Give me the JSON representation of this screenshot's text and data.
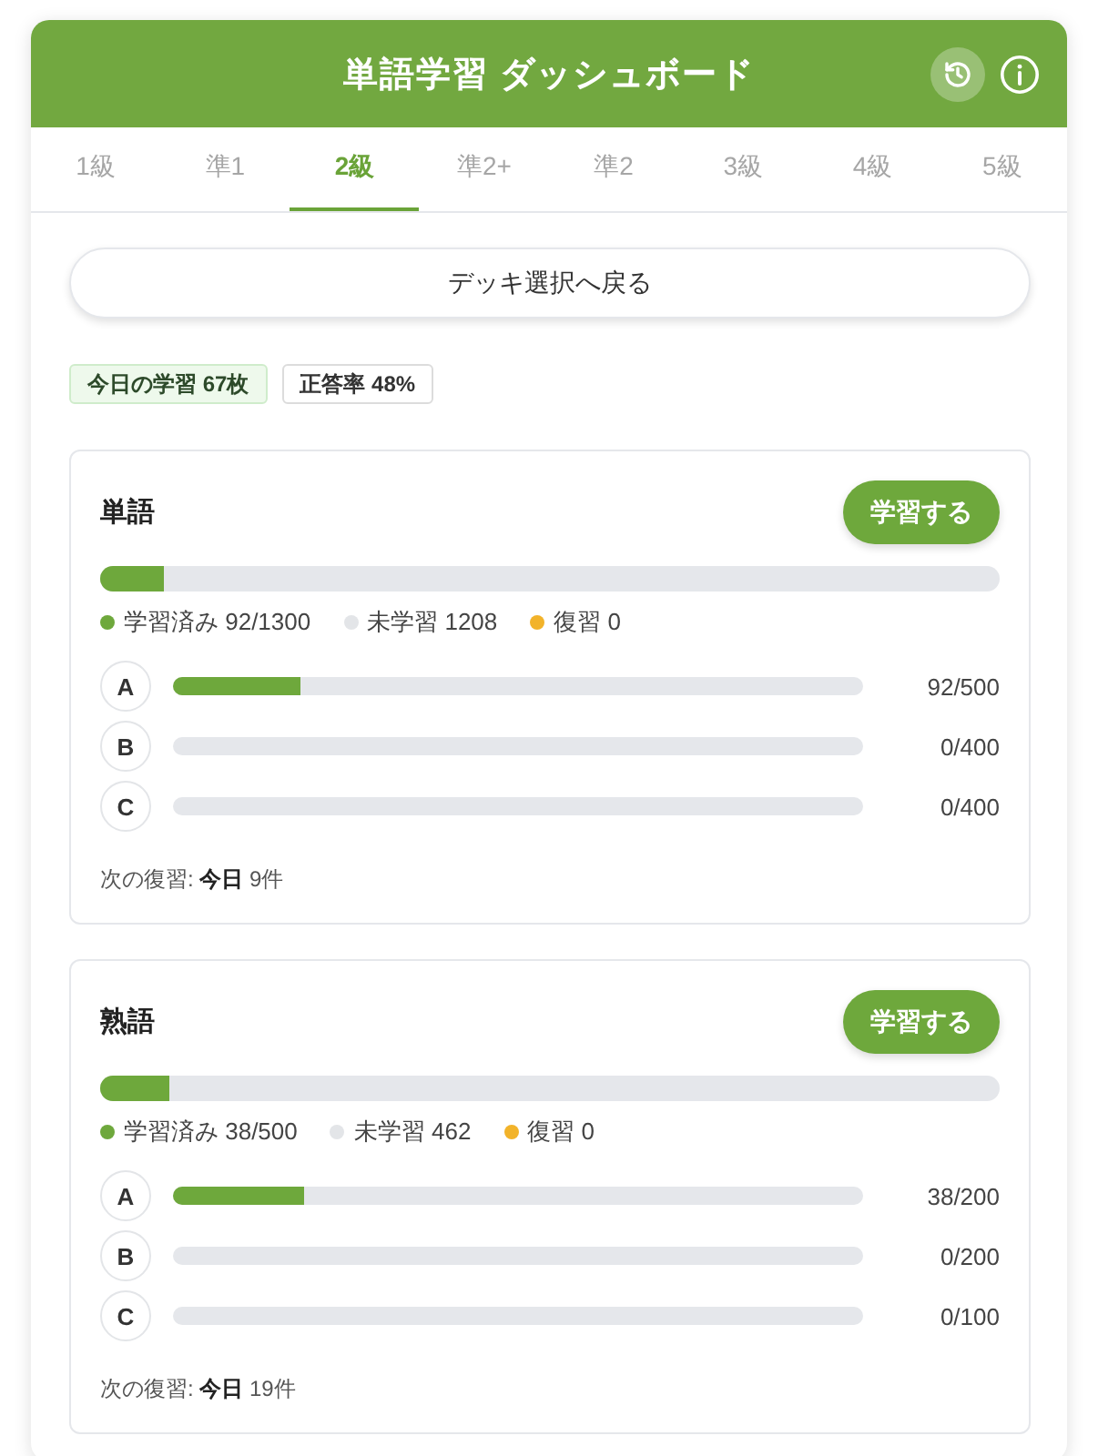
{
  "header": {
    "title": "単語学習 ダッシュボード"
  },
  "tabs": [
    {
      "label": "1級",
      "selected": false
    },
    {
      "label": "準1",
      "selected": false
    },
    {
      "label": "2級",
      "selected": true
    },
    {
      "label": "準2+",
      "selected": false
    },
    {
      "label": "準2",
      "selected": false
    },
    {
      "label": "3級",
      "selected": false
    },
    {
      "label": "4級",
      "selected": false
    },
    {
      "label": "5級",
      "selected": false
    }
  ],
  "back_button": {
    "label": "デッキ選択へ戻る"
  },
  "stats": [
    {
      "label": "今日の学習 67枚",
      "kind": "highlight"
    },
    {
      "label": "正答率 48%",
      "kind": "plain"
    }
  ],
  "decks": [
    {
      "title": "単語",
      "button": "学習する",
      "level": 0.071,
      "legend": [
        {
          "label": "学習済み 92/1300",
          "color": "#6ea83c"
        },
        {
          "label": "未学習 1208",
          "color": "#e3e5e8"
        },
        {
          "label": "復習 0",
          "color": "#f2b32a"
        }
      ],
      "groups": [
        {
          "letter": "A",
          "level": 0.184,
          "count": "92/500"
        },
        {
          "letter": "B",
          "count": "0/400"
        },
        {
          "letter": "C",
          "count": "0/400"
        }
      ],
      "next_review": "次の復習: **今日** 9件"
    },
    {
      "title": "熟語",
      "button": "学習する",
      "level": 0.076,
      "legend": [
        {
          "label": "学習済み 38/500",
          "color": "#6ea83c"
        },
        {
          "label": "未学習 462",
          "color": "#e3e5e8"
        },
        {
          "label": "復習 0",
          "color": "#f2b32a"
        }
      ],
      "groups": [
        {
          "letter": "A",
          "level": 0.19,
          "count": "38/200"
        },
        {
          "letter": "B",
          "count": "0/200"
        },
        {
          "letter": "C",
          "count": "0/100"
        }
      ],
      "next_review": "次の復習: **今日** 19件"
    }
  ]
}
